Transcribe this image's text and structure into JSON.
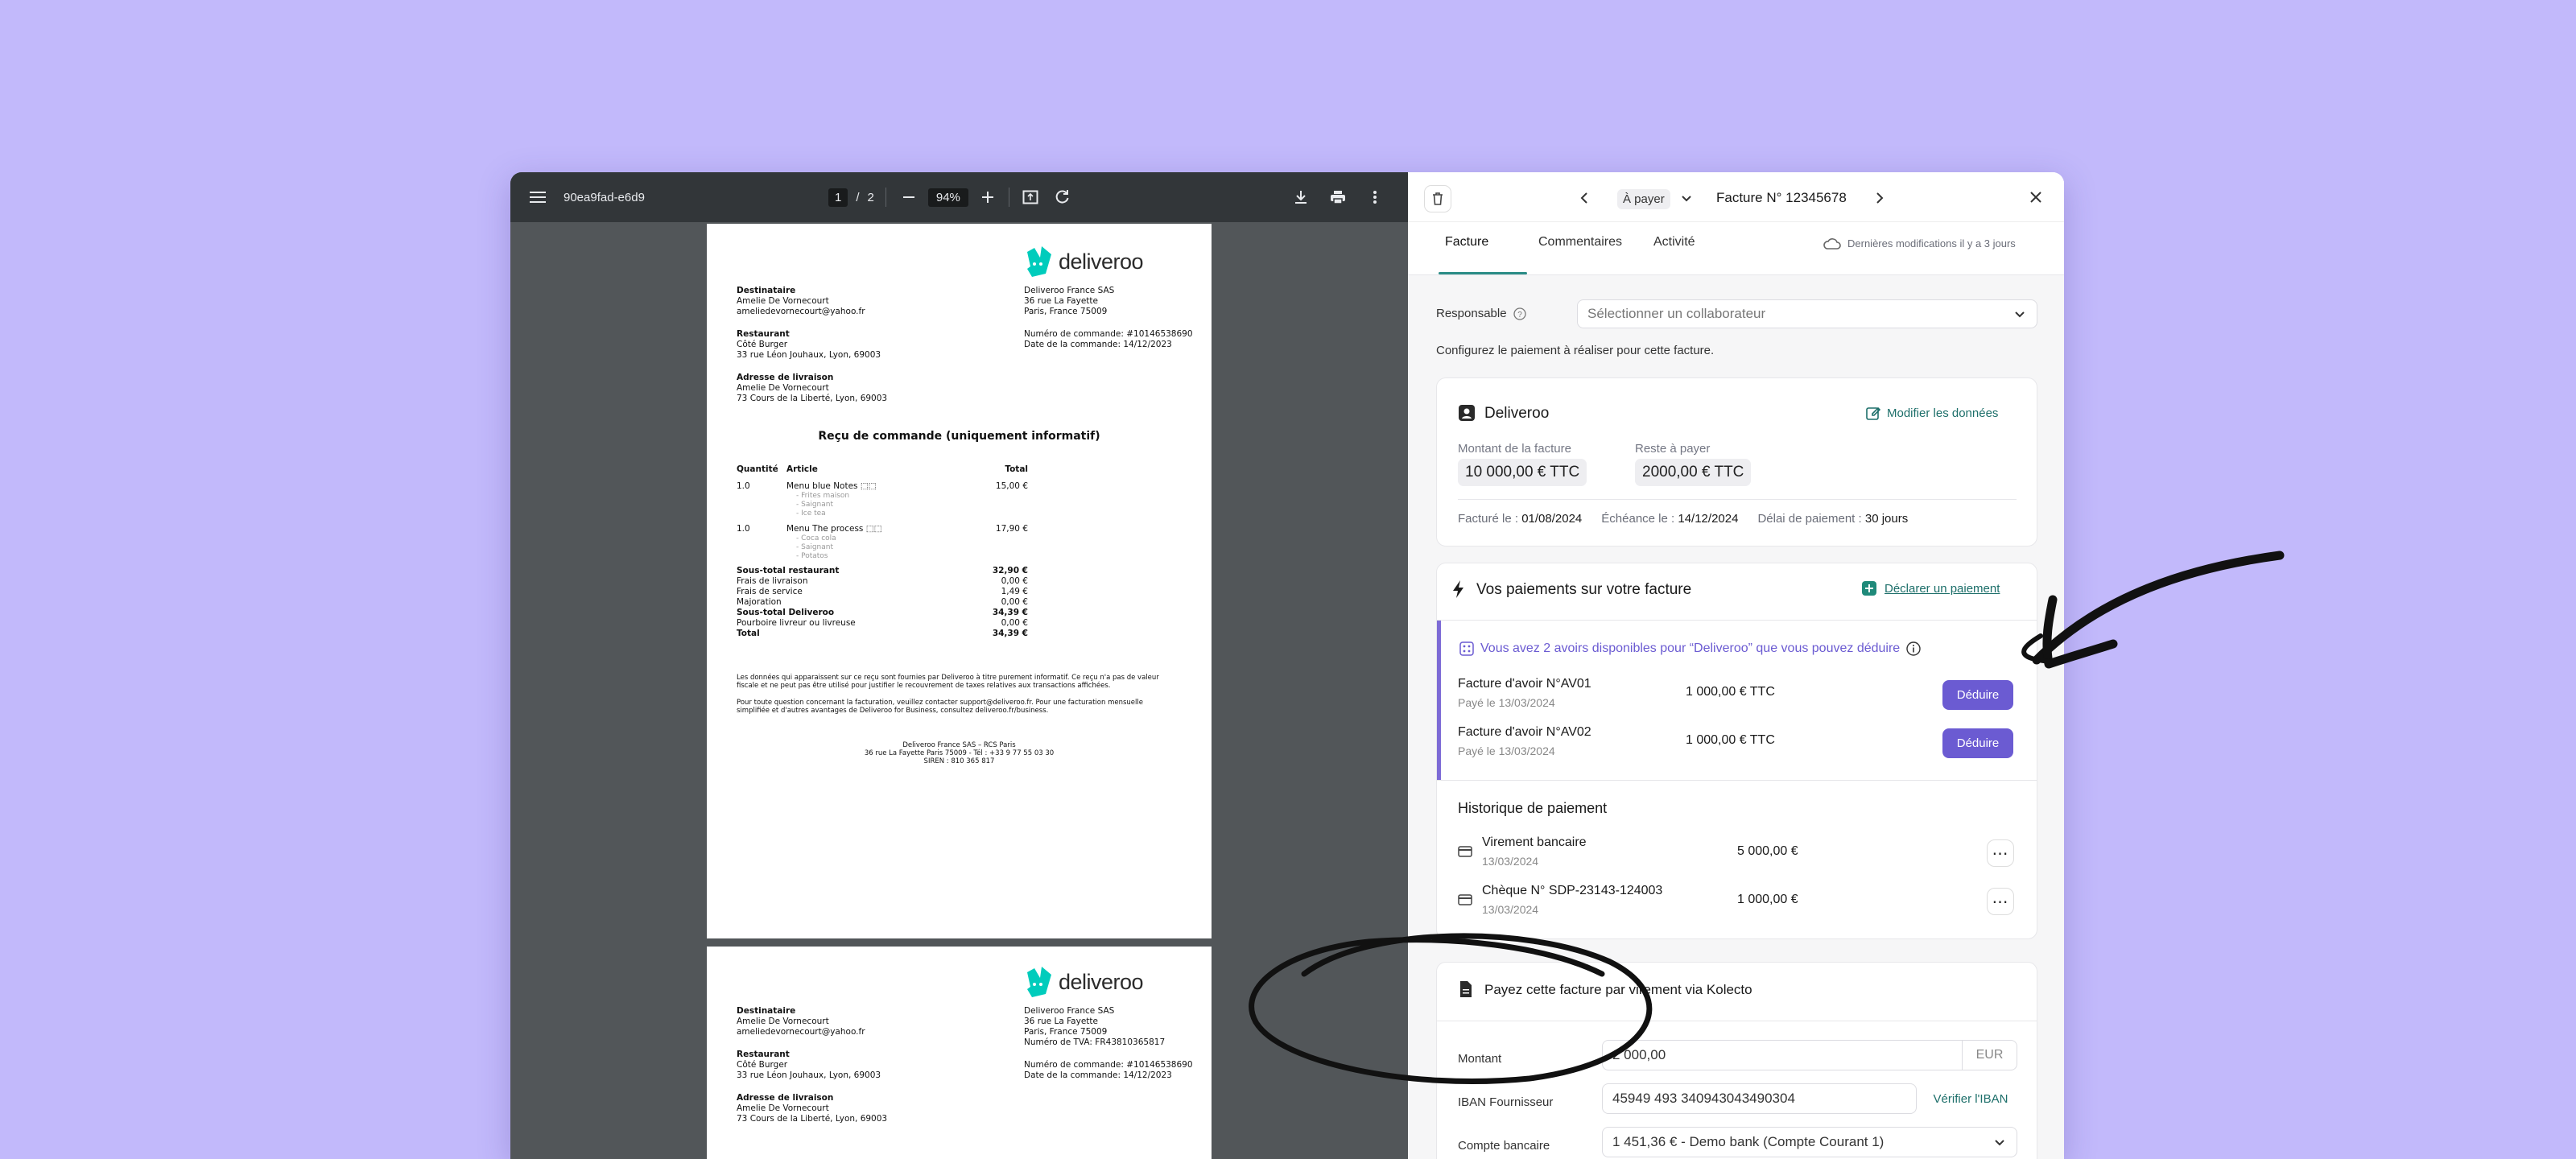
{
  "pdf_viewer": {
    "filename": "90ea9fad-e6d9",
    "page_current": "1",
    "page_sep": "/",
    "page_total": "2",
    "zoom": "94%",
    "icons": [
      "menu-icon",
      "zoom-out-icon",
      "zoom-in-icon",
      "fit-page-icon",
      "rotate-icon",
      "download-icon",
      "print-icon",
      "more-vert-icon"
    ]
  },
  "receipt": {
    "brand": "deliveroo",
    "recipient_label": "Destinataire",
    "recipient_name": "Amelie De Vornecourt",
    "recipient_email": "ameliedevornecourt@yahoo.fr",
    "restaurant_label": "Restaurant",
    "restaurant_name": "Côté Burger",
    "restaurant_address": "33 rue Léon Jouhaux, Lyon, 69003",
    "delivery_label": "Adresse de livraison",
    "delivery_name": "Amelie De Vornecourt",
    "delivery_address": "73 Cours de la Liberté, Lyon, 69003",
    "company_name": "Deliveroo France SAS",
    "company_street": "36 rue La Fayette",
    "company_city": "Paris, France 75009",
    "order_number": "Numéro de commande: #10146538690",
    "order_date": "Date de la commande: 14/12/2023",
    "vat_number": "Numéro de TVA: FR43810365817",
    "title": "Reçu de commande (uniquement informatif)",
    "col_qty": "Quantité",
    "col_item": "Article",
    "col_total": "Total",
    "items": [
      {
        "qty": "1.0",
        "name": "Menu blue Notes ⬚⬚",
        "total": "15,00 €",
        "options": [
          "- Frites maison",
          "- Saignant",
          "- Ice tea"
        ]
      },
      {
        "qty": "1.0",
        "name": "Menu The process ⬚⬚",
        "total": "17,90 €",
        "options": [
          "- Coca cola",
          "- Saignant",
          "- Potatos"
        ]
      }
    ],
    "summary": [
      {
        "label": "Sous-total restaurant",
        "value": "32,90 €",
        "bold": true
      },
      {
        "label": "Frais de livraison",
        "value": "0,00 €",
        "bold": false
      },
      {
        "label": "Frais de service",
        "value": "1,49 €",
        "bold": false
      },
      {
        "label": "Majoration",
        "value": "0,00 €",
        "bold": false
      },
      {
        "label": "Sous-total Deliveroo",
        "value": "34,39 €",
        "bold": true
      },
      {
        "label": "Pourboire livreur ou livreuse",
        "value": "0,00 €",
        "bold": false
      },
      {
        "label": "Total",
        "value": "34,39 €",
        "bold": true
      }
    ],
    "disclaimer1": "Les données qui apparaissent sur ce reçu sont fournies par Deliveroo à titre purement informatif. Ce reçu n'a pas de valeur fiscale et ne peut pas être utilisé pour justifier le recouvrement de taxes relatives aux transactions affichées.",
    "disclaimer2": "Pour toute question concernant la facturation, veuillez contacter support@deliveroo.fr. Pour une facturation mensuelle simplifiée et d'autres avantages de Deliveroo for Business, consultez deliveroo.fr/business.",
    "footer1": "Deliveroo France SAS – RCS Paris",
    "footer2": "36 rue La Fayette Paris 75009 - Tél : +33 9 77 55 03 30",
    "footer3": "SIREN : 810 365 817"
  },
  "panel": {
    "status": "À payer",
    "invoice_title": "Facture N° 12345678",
    "tabs": [
      "Facture",
      "Commentaires",
      "Activité"
    ],
    "last_modified": "Dernières modifications il y a 3 jours",
    "responsable_label": "Responsable",
    "responsable_placeholder": "Sélectionner un collaborateur",
    "configure_text": "Configurez le paiement à réaliser pour cette facture.",
    "supplier": {
      "name": "Deliveroo",
      "edit_label": "Modifier les données",
      "amount_label": "Montant de la facture",
      "amount_value": "10 000,00 € TTC",
      "remaining_label": "Reste à payer",
      "remaining_value": "2000,00 € TTC",
      "invoiced_label": "Facturé le :",
      "invoiced_value": "01/08/2024",
      "due_label": "Échéance le :",
      "due_value": "14/12/2024",
      "delay_label": "Délai de paiement :",
      "delay_value": "30 jours"
    },
    "payments": {
      "title": "Vos paiements sur votre facture",
      "declare_label": "Déclarer un paiement",
      "credits_notice": "Vous avez 2 avoirs disponibles pour “Deliveroo” que vous pouvez déduire",
      "credits": [
        {
          "name": "Facture d'avoir N°AV01",
          "date": "Payé le 13/03/2024",
          "amount": "1 000,00 € TTC",
          "action": "Déduire"
        },
        {
          "name": "Facture d'avoir N°AV02",
          "date": "Payé le 13/03/2024",
          "amount": "1 000,00 € TTC",
          "action": "Déduire"
        }
      ],
      "history_title": "Historique de paiement",
      "history": [
        {
          "name": "Virement bancaire",
          "date": "13/03/2024",
          "amount": "5 000,00 €"
        },
        {
          "name": "Chèque N° SDP-23143-124003",
          "date": "13/03/2024",
          "amount": "1 000,00 €"
        }
      ]
    },
    "pay": {
      "title": "Payez cette facture par virement via Kolecto",
      "amount_label": "Montant",
      "amount_value": "2 000,00",
      "currency": "EUR",
      "iban_label": "IBAN Fournisseur",
      "iban_value": "45949 493 340943043490304",
      "verify_label": "Vérifier l'IBAN",
      "account_label": "Compte bancaire",
      "account_value": "1 451,36 € - Demo bank (Compte Courant 1)"
    }
  },
  "colors": {
    "background": "#c2b9fb",
    "accent_teal": "#2a8c86",
    "accent_purple": "#6b5bd2",
    "deliveroo_teal": "#00ccbc"
  }
}
